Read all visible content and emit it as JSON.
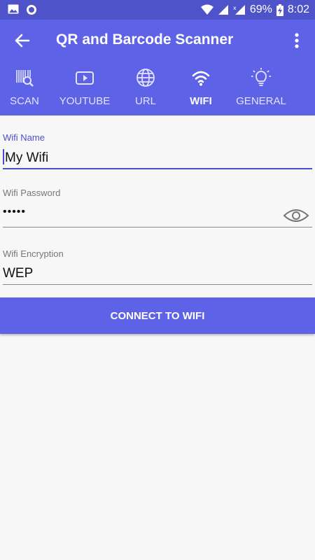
{
  "status_bar": {
    "battery": "69%",
    "time": "8:02"
  },
  "app_bar": {
    "title": "QR and Barcode Scanner"
  },
  "tabs": [
    {
      "label": "SCAN",
      "icon": "barcode-scan-icon"
    },
    {
      "label": "YOUTUBE",
      "icon": "youtube-icon"
    },
    {
      "label": "URL",
      "icon": "globe-icon"
    },
    {
      "label": "WIFI",
      "icon": "wifi-icon",
      "active": true
    },
    {
      "label": "GENERAL",
      "icon": "lightbulb-icon"
    }
  ],
  "form": {
    "wifi_name": {
      "label": "Wifi Name",
      "value": "My Wifi"
    },
    "wifi_password": {
      "label": "Wifi Password",
      "value": "•••••"
    },
    "wifi_encryption": {
      "label": "Wifi Encryption",
      "value": "WEP"
    }
  },
  "button": {
    "label": "CONNECT TO WIFI"
  },
  "colors": {
    "primary": "#5d62e6",
    "status_bar": "#4f53c9",
    "accent": "#4c4fc9",
    "background": "#f7f7f7"
  }
}
